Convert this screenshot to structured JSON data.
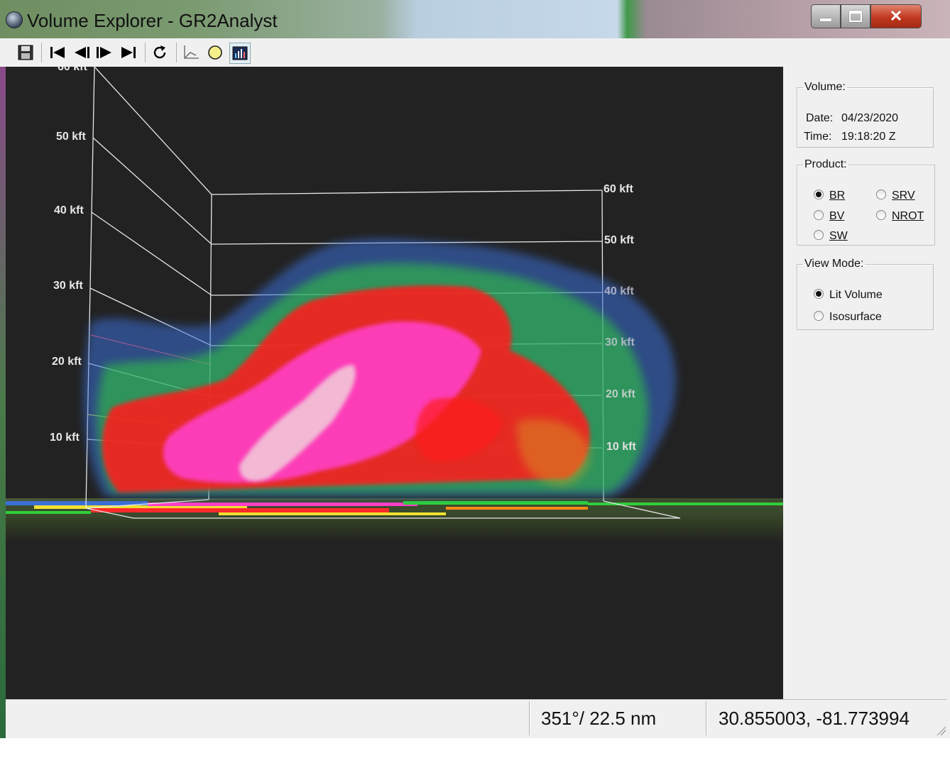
{
  "window": {
    "title": "Volume Explorer - GR2Analyst"
  },
  "toolbar": {
    "buttons": [
      {
        "name": "save",
        "icon": "floppy-icon"
      },
      {
        "name": "first",
        "icon": "skip-first-icon"
      },
      {
        "name": "prev",
        "icon": "step-back-icon"
      },
      {
        "name": "next",
        "icon": "step-forward-icon"
      },
      {
        "name": "last",
        "icon": "skip-last-icon"
      },
      {
        "name": "refresh",
        "icon": "refresh-icon"
      },
      {
        "name": "cross-section",
        "icon": "cross-section-icon"
      },
      {
        "name": "circle",
        "icon": "circle-icon"
      },
      {
        "name": "color-table",
        "icon": "color-table-icon"
      }
    ]
  },
  "viewport": {
    "left_axis": [
      "60 kft",
      "50 kft",
      "40 kft",
      "30 kft",
      "20 kft",
      "10 kft"
    ],
    "right_axis": [
      "60 kft",
      "50 kft",
      "40 kft",
      "30 kft",
      "20 kft",
      "10 kft"
    ]
  },
  "volume": {
    "legend": "Volume:",
    "date_label": "Date:",
    "date_value": "04/23/2020",
    "time_label": "Time:",
    "time_value": "19:18:20 Z"
  },
  "product": {
    "legend": "Product:",
    "options": [
      {
        "label": "BR",
        "selected": true
      },
      {
        "label": "SRV",
        "selected": false
      },
      {
        "label": "BV",
        "selected": false
      },
      {
        "label": "NROT",
        "selected": false
      },
      {
        "label": "SW",
        "selected": false
      }
    ]
  },
  "view_mode": {
    "legend": "View Mode:",
    "options": [
      {
        "label": "Lit Volume",
        "selected": true
      },
      {
        "label": "Isosurface",
        "selected": false
      }
    ]
  },
  "status": {
    "bearing_range": "351°/ 22.5 nm",
    "coordinates": "30.855003, -81.773994"
  },
  "colors": {
    "viewport_bg": "#222222",
    "reflectivity_low": "#3b6fd8",
    "reflectivity_mid": "#2fcf3a",
    "reflectivity_high": "#ff1a1a",
    "reflectivity_extreme": "#ff3fc8"
  }
}
